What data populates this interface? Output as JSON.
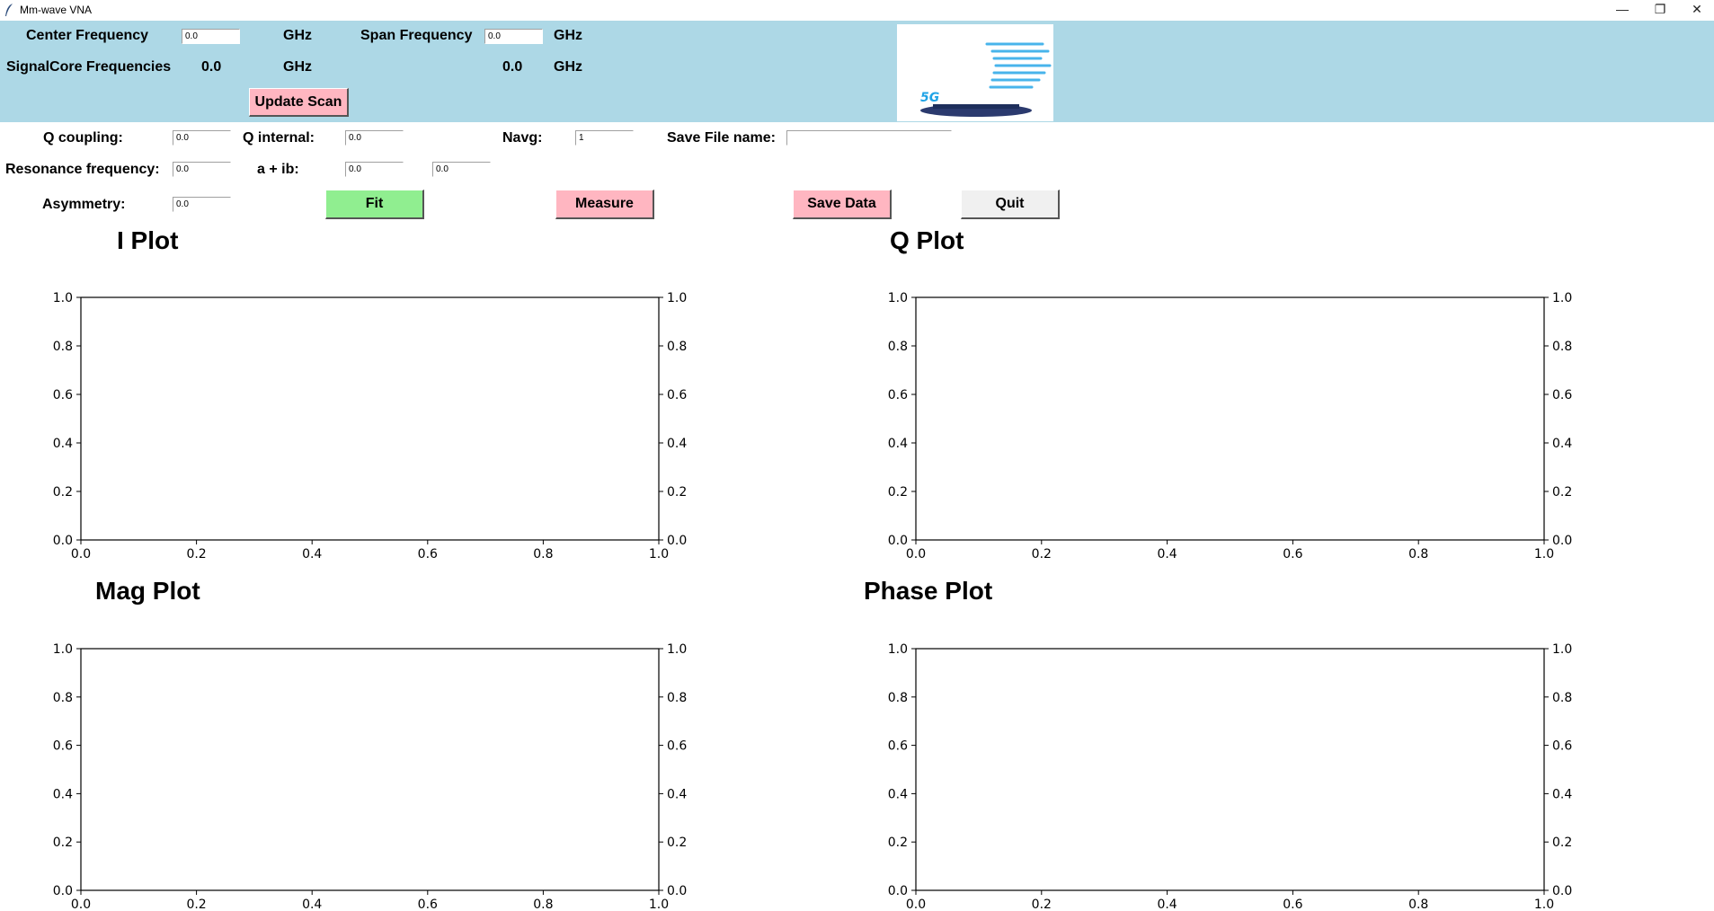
{
  "window": {
    "title": "Mm-wave VNA",
    "controls": {
      "minimize": "—",
      "restore": "❐",
      "close": "✕"
    }
  },
  "header": {
    "center_frequency_label": "Center Frequency",
    "center_frequency_value": "0.0",
    "center_frequency_unit": "GHz",
    "span_frequency_label": "Span Frequency",
    "span_frequency_value": "0.0",
    "span_frequency_unit": "GHz",
    "signalcore_label": "SignalCore Frequencies",
    "signalcore_value_1": "0.0",
    "signalcore_unit_1": "GHz",
    "signalcore_value_2": "0.0",
    "signalcore_unit_2": "GHz",
    "update_scan_label": "Update Scan",
    "logo_icon": "5g-logo-icon",
    "logo_text": "5G"
  },
  "params": {
    "q_coupling_label": "Q coupling:",
    "q_coupling_value": "0.0",
    "q_internal_label": "Q internal:",
    "q_internal_value": "0.0",
    "navg_label": "Navg:",
    "navg_value": "1",
    "save_file_label": "Save File name:",
    "save_file_value": "",
    "resonance_label": "Resonance frequency:",
    "resonance_value": "0.0",
    "aib_label": "a + ib:",
    "a_value": "0.0",
    "b_value": "0.0",
    "asymmetry_label": "Asymmetry:",
    "asymmetry_value": "0.0"
  },
  "buttons": {
    "fit": "Fit",
    "measure": "Measure",
    "save_data": "Save Data",
    "quit": "Quit"
  },
  "colors": {
    "header_bg": "#add8e6",
    "pink_button": "#ffb6c1",
    "green_button": "#90ee90",
    "grey_button": "#f0f0f0"
  },
  "chart_data": [
    {
      "type": "line",
      "title": "I Plot",
      "xlim": [
        0.0,
        1.0
      ],
      "ylim": [
        0.0,
        1.0
      ],
      "xticks": [
        "0.0",
        "0.2",
        "0.4",
        "0.6",
        "0.8",
        "1.0"
      ],
      "yticks": [
        "0.0",
        "0.2",
        "0.4",
        "0.6",
        "0.8",
        "1.0"
      ],
      "series": []
    },
    {
      "type": "line",
      "title": "Q Plot",
      "xlim": [
        0.0,
        1.0
      ],
      "ylim": [
        0.0,
        1.0
      ],
      "xticks": [
        "0.0",
        "0.2",
        "0.4",
        "0.6",
        "0.8",
        "1.0"
      ],
      "yticks": [
        "0.0",
        "0.2",
        "0.4",
        "0.6",
        "0.8",
        "1.0"
      ],
      "series": []
    },
    {
      "type": "line",
      "title": "Mag Plot",
      "xlim": [
        0.0,
        1.0
      ],
      "ylim": [
        0.0,
        1.0
      ],
      "xticks": [
        "0.0",
        "0.2",
        "0.4",
        "0.6",
        "0.8",
        "1.0"
      ],
      "yticks": [
        "0.0",
        "0.2",
        "0.4",
        "0.6",
        "0.8",
        "1.0"
      ],
      "series": []
    },
    {
      "type": "line",
      "title": "Phase Plot",
      "xlim": [
        0.0,
        1.0
      ],
      "ylim": [
        0.0,
        1.0
      ],
      "xticks": [
        "0.0",
        "0.2",
        "0.4",
        "0.6",
        "0.8",
        "1.0"
      ],
      "yticks": [
        "0.0",
        "0.2",
        "0.4",
        "0.6",
        "0.8",
        "1.0"
      ],
      "series": []
    }
  ]
}
